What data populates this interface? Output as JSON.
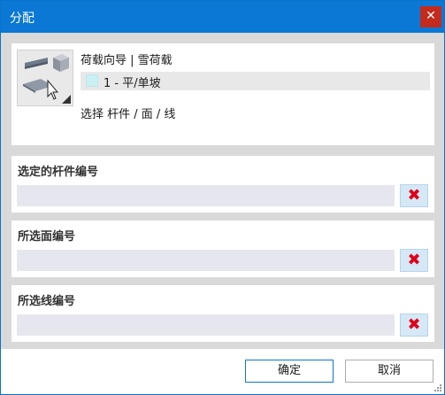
{
  "window": {
    "title": "分配",
    "close_glyph": "✕"
  },
  "header": {
    "wizard_label": "荷载向导 | 雪荷载",
    "load_case": "1 - 平/单坡",
    "select_hint": "选择 杆件 / 面 / 线",
    "load_swatch_color": "#c9f1f4"
  },
  "groups": [
    {
      "title": "选定的杆件编号",
      "value": ""
    },
    {
      "title": "所选面编号",
      "value": ""
    },
    {
      "title": "所选线编号",
      "value": ""
    }
  ],
  "footer": {
    "ok_label": "确定",
    "cancel_label": "取消"
  },
  "icons": {
    "clear": "✖",
    "clear_color": "#e0001a"
  }
}
